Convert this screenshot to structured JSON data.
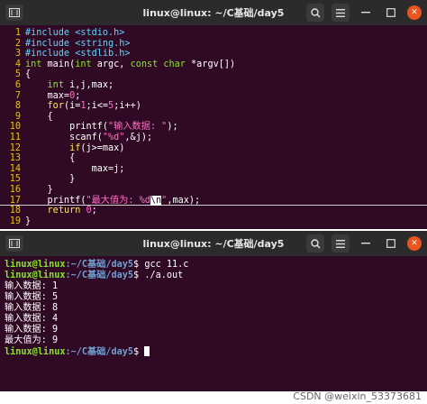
{
  "editor_window": {
    "title": "linux@linux: ~/C基础/day5",
    "lines": [
      {
        "n": "1",
        "parts": [
          [
            "pp",
            "#include <stdio.h>"
          ]
        ]
      },
      {
        "n": "2",
        "parts": [
          [
            "pp",
            "#include <string.h>"
          ]
        ]
      },
      {
        "n": "3",
        "parts": [
          [
            "pp",
            "#include <stdlib.h>"
          ]
        ]
      },
      {
        "n": "4",
        "parts": [
          [
            "ty",
            "int"
          ],
          [
            "src",
            " main("
          ],
          [
            "ty",
            "int"
          ],
          [
            "src",
            " argc, "
          ],
          [
            "ty",
            "const char"
          ],
          [
            "src",
            " *argv[])"
          ]
        ]
      },
      {
        "n": "5",
        "parts": [
          [
            "src",
            "{"
          ]
        ]
      },
      {
        "n": "6",
        "parts": [
          [
            "src",
            "    "
          ],
          [
            "ty",
            "int"
          ],
          [
            "src",
            " i,j,max;"
          ]
        ]
      },
      {
        "n": "7",
        "parts": [
          [
            "src",
            "    max="
          ],
          [
            "num",
            "0"
          ],
          [
            "src",
            ";"
          ]
        ]
      },
      {
        "n": "8",
        "parts": [
          [
            "src",
            "    "
          ],
          [
            "kw",
            "for"
          ],
          [
            "src",
            "(i="
          ],
          [
            "num",
            "1"
          ],
          [
            "src",
            ";i<="
          ],
          [
            "num",
            "5"
          ],
          [
            "src",
            ";i++)"
          ]
        ]
      },
      {
        "n": "9",
        "parts": [
          [
            "src",
            "    {"
          ]
        ]
      },
      {
        "n": "10",
        "parts": [
          [
            "src",
            "        printf("
          ],
          [
            "str",
            "\"输入数据: \""
          ],
          [
            "src",
            ");"
          ]
        ]
      },
      {
        "n": "11",
        "parts": [
          [
            "src",
            "        scanf("
          ],
          [
            "str",
            "\"%d\""
          ],
          [
            "src",
            ",&j);"
          ]
        ]
      },
      {
        "n": "12",
        "parts": [
          [
            "src",
            "        "
          ],
          [
            "kw",
            "if"
          ],
          [
            "src",
            "(j>=max)"
          ]
        ]
      },
      {
        "n": "13",
        "parts": [
          [
            "src",
            "        {"
          ]
        ]
      },
      {
        "n": "14",
        "parts": [
          [
            "src",
            "            max=j;"
          ]
        ]
      },
      {
        "n": "15",
        "parts": [
          [
            "src",
            "        }"
          ]
        ]
      },
      {
        "n": "16",
        "parts": [
          [
            "src",
            "    }"
          ]
        ]
      },
      {
        "n": "17",
        "parts": [
          [
            "src",
            "    printf("
          ],
          [
            "str",
            "\"最大值为: %d"
          ],
          [
            "cur",
            "\\n"
          ],
          [
            "str",
            "\""
          ],
          [
            "src",
            ",max);"
          ]
        ],
        "cursor": true
      },
      {
        "n": "18",
        "parts": [
          [
            "src",
            "    "
          ],
          [
            "kw",
            "return"
          ],
          [
            "src",
            " "
          ],
          [
            "num",
            "0"
          ],
          [
            "src",
            ";"
          ]
        ]
      },
      {
        "n": "19",
        "parts": [
          [
            "src",
            "}"
          ]
        ]
      }
    ]
  },
  "terminal_window": {
    "title": "linux@linux: ~/C基础/day5",
    "prompt_user": "linux@linux",
    "prompt_path": ":~/C基础/day5",
    "prompt_symbol": "$ ",
    "commands": [
      "gcc 11.c",
      "./a.out"
    ],
    "output": [
      "输入数据: 1",
      "输入数据: 5",
      "输入数据: 8",
      "输入数据: 4",
      "输入数据: 9",
      "最大值为: 9"
    ]
  },
  "watermark": "CSDN @weixin_53373681"
}
